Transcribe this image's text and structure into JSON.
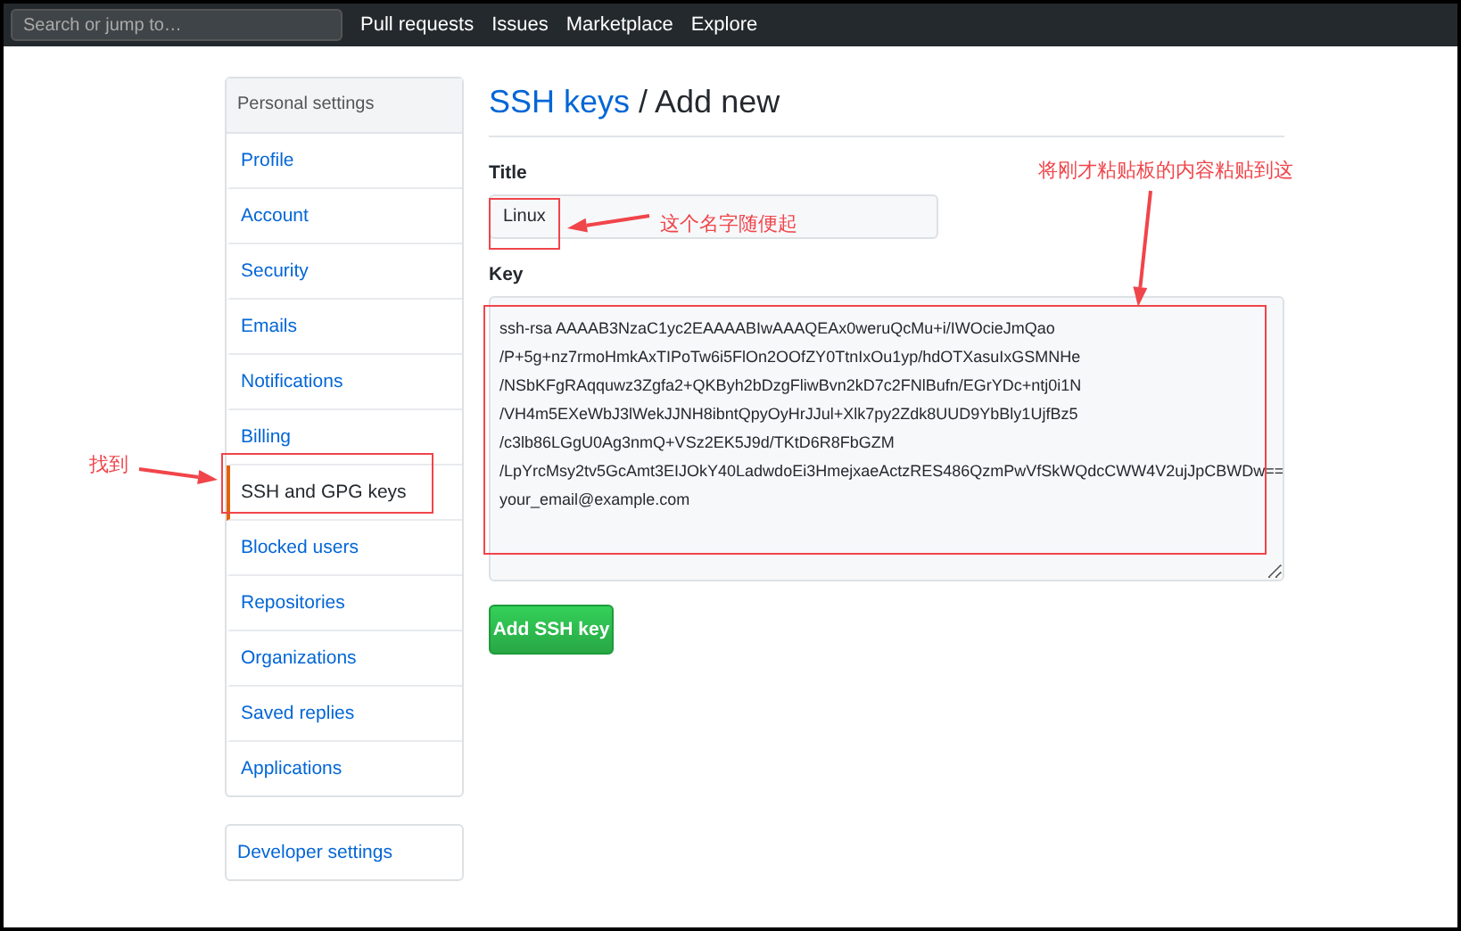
{
  "top_nav": {
    "search": {
      "placeholder": "Search or jump to…"
    },
    "links": [
      "Pull requests",
      "Issues",
      "Marketplace",
      "Explore"
    ]
  },
  "sidebar": {
    "heading": "Personal settings",
    "items": [
      {
        "label": "Profile",
        "selected": false
      },
      {
        "label": "Account",
        "selected": false
      },
      {
        "label": "Security",
        "selected": false
      },
      {
        "label": "Emails",
        "selected": false
      },
      {
        "label": "Notifications",
        "selected": false
      },
      {
        "label": "Billing",
        "selected": false
      },
      {
        "label": "SSH and GPG keys",
        "selected": true
      },
      {
        "label": "Blocked users",
        "selected": false
      },
      {
        "label": "Repositories",
        "selected": false
      },
      {
        "label": "Organizations",
        "selected": false
      },
      {
        "label": "Saved replies",
        "selected": false
      },
      {
        "label": "Applications",
        "selected": false
      }
    ],
    "developer": "Developer settings"
  },
  "main": {
    "breadcrumb_link": "SSH keys",
    "page_title": "/ Add new",
    "title_label": "Title",
    "title_value": "Linux",
    "key_label": "Key",
    "key_lines": [
      "ssh-rsa AAAAB3NzaC1yc2EAAAABIwAAAQEAx0weruQcMu+i/IWOcieJmQao",
      "/P+5g+nz7rmoHmkAxTIPoTw6i5FlOn2OOfZY0TtnIxOu1yp/hdOTXasuIxGSMNHe",
      "/NSbKFgRAqquwz3Zgfa2+QKByh2bDzgFliwBvn2kD7c2FNlBufn/EGrYDc+ntj0i1N",
      "/VH4m5EXeWbJ3lWekJJNH8ibntQpyOyHrJJul+Xlk7py2Zdk8UUD9YbBly1UjfBz5",
      "/c3lb86LGgU0Ag3nmQ+VSz2EK5J9d/TKtD6R8FbGZM",
      "/LpYrcMsy2tv5GcAmt3EIJOkY40LadwdoEi3HmejxaeActzRES486QzmPwVfSkWQdcCWW4V2ujJpCBWDw==",
      "your_email@example.com"
    ],
    "submit": "Add SSH key"
  },
  "annotations": {
    "find": "找到",
    "name_hint": "这个名字随便起",
    "paste_hint": "将刚才粘贴板的内容粘贴到这"
  }
}
